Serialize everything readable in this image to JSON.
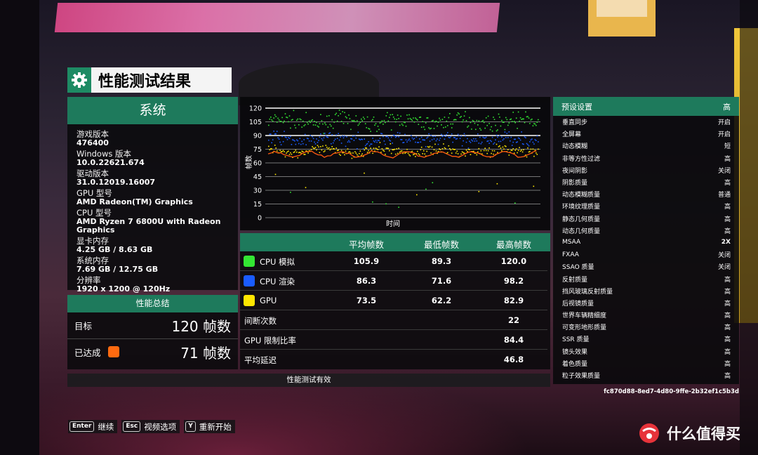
{
  "title": "性能测试结果",
  "system": {
    "header": "系统",
    "items": [
      {
        "label": "游戏版本",
        "value": "476400"
      },
      {
        "label": "Windows 版本",
        "value": "10.0.22621.674"
      },
      {
        "label": "驱动版本",
        "value": "31.0.12019.16007"
      },
      {
        "label": "GPU 型号",
        "value": "AMD Radeon(TM) Graphics"
      },
      {
        "label": "CPU 型号",
        "value": "AMD Ryzen 7 6800U with Radeon Graphics"
      },
      {
        "label": "显卡内存",
        "value": "4.25 GB / 8.63 GB"
      },
      {
        "label": "系统内存",
        "value": "7.69 GB / 12.75 GB"
      },
      {
        "label": "分辨率",
        "value": "1920 x 1200 @ 120Hz"
      }
    ]
  },
  "summary": {
    "header": "性能总结",
    "target_label": "目标",
    "target_value": "120 帧数",
    "achieved_label": "已达成",
    "achieved_value": "71 帧数",
    "achieved_color": "#ff6a10"
  },
  "chart_data": {
    "type": "scatter",
    "title": "",
    "xlabel": "时间",
    "ylabel": "帧数",
    "ylim": [
      0,
      120
    ],
    "yticks": [
      0,
      15,
      30,
      45,
      60,
      75,
      90,
      105,
      120
    ],
    "highlight_lines": [
      90,
      120
    ],
    "series": [
      {
        "name": "CPU 模拟",
        "color": "#33e633",
        "avg": 105.9,
        "min": 89.3,
        "max": 120.0
      },
      {
        "name": "CPU 渲染",
        "color": "#1a5cff",
        "avg": 86.3,
        "min": 71.6,
        "max": 98.2
      },
      {
        "name": "GPU",
        "color": "#ffe600",
        "avg": 73.5,
        "min": 62.2,
        "max": 82.9
      }
    ]
  },
  "stats": {
    "headers": [
      "平均帧数",
      "最低帧数",
      "最高帧数"
    ],
    "rows": [
      {
        "label": "CPU 模拟",
        "color": "#33e633",
        "avg": "105.9",
        "min": "89.3",
        "max": "120.0"
      },
      {
        "label": "CPU 渲染",
        "color": "#1a5cff",
        "avg": "86.3",
        "min": "71.6",
        "max": "98.2"
      },
      {
        "label": "GPU",
        "color": "#ffe600",
        "avg": "73.5",
        "min": "62.2",
        "max": "82.9"
      }
    ],
    "extra": [
      {
        "label": "间断次数",
        "value": "22"
      },
      {
        "label": "GPU 限制比率",
        "value": "84.4"
      },
      {
        "label": "平均延迟",
        "value": "46.8"
      }
    ]
  },
  "valid_text": "性能测试有效",
  "settings": {
    "header_label": "预设设置",
    "header_value": "高",
    "rows": [
      {
        "label": "垂直同步",
        "value": "开启"
      },
      {
        "label": "全屏幕",
        "value": "开启"
      },
      {
        "label": "动态模糊",
        "value": "短"
      },
      {
        "label": "非等方性过滤",
        "value": "高"
      },
      {
        "label": "夜间阴影",
        "value": "关闭"
      },
      {
        "label": "阴影质量",
        "value": "高"
      },
      {
        "label": "动态模糊质量",
        "value": "普通"
      },
      {
        "label": "环境纹理质量",
        "value": "高"
      },
      {
        "label": "静态几何质量",
        "value": "高"
      },
      {
        "label": "动态几何质量",
        "value": "高"
      },
      {
        "label": "MSAA",
        "value": "2X"
      },
      {
        "label": "FXAA",
        "value": "关闭"
      },
      {
        "label": "SSAO 质量",
        "value": "关闭"
      },
      {
        "label": "反射质量",
        "value": "高"
      },
      {
        "label": "挡风玻璃反射质量",
        "value": "高"
      },
      {
        "label": "后视镜质量",
        "value": "高"
      },
      {
        "label": "世界车辆精细度",
        "value": "高"
      },
      {
        "label": "可变形地形质量",
        "value": "高"
      },
      {
        "label": "SSR 质量",
        "value": "高"
      },
      {
        "label": "镜头效果",
        "value": "高"
      },
      {
        "label": "着色质量",
        "value": "高"
      },
      {
        "label": "粒子效果质量",
        "value": "高"
      }
    ]
  },
  "uuid": "fc870d88-8ed7-4d80-9ffe-2b32ef1c5b3d",
  "hints": [
    {
      "key": "Enter",
      "label": "继续"
    },
    {
      "key": "Esc",
      "label": "视频选项"
    },
    {
      "key": "Y",
      "label": "重新开始"
    }
  ],
  "watermark": "什么值得买",
  "colors": {
    "accent": "#1e7a5c",
    "watermark": "#e7333a"
  }
}
